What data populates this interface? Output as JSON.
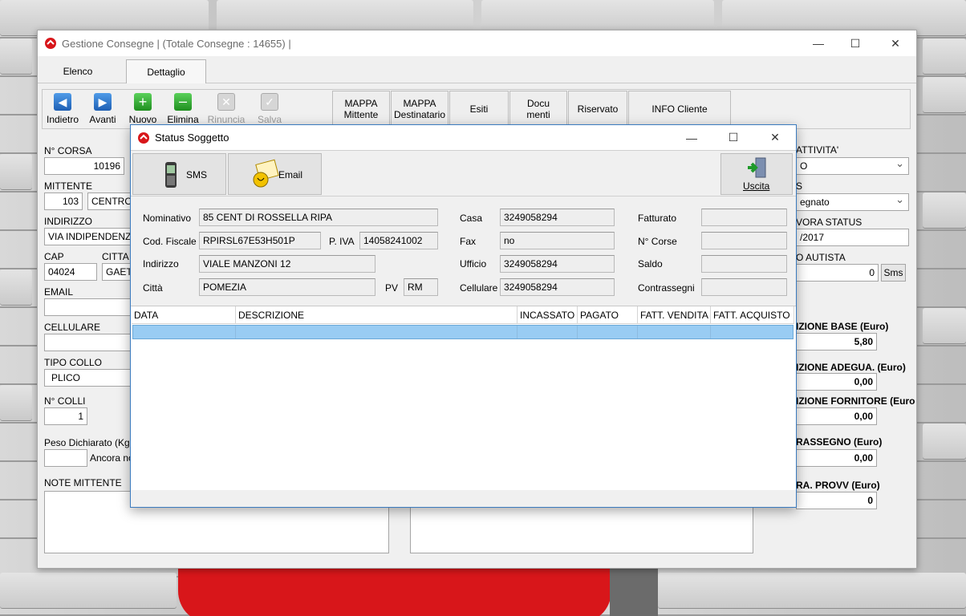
{
  "main": {
    "title": "Gestione Consegne | (Totale Consegne : 14655) |",
    "tabs": [
      {
        "label": "Elenco"
      },
      {
        "label": "Dettaglio"
      }
    ],
    "toolbar": {
      "indietro": "Indietro",
      "avanti": "Avanti",
      "nuovo": "Nuovo",
      "elimina": "Elimina",
      "rinuncia": "Rinuncia",
      "salva": "Salva"
    },
    "nav": {
      "mappa_mittente": [
        "MAPPA",
        "Mittente"
      ],
      "mappa_destinatario": [
        "MAPPA",
        "Destinatario"
      ],
      "esiti": "Esiti",
      "documenti": [
        "Docu",
        "menti"
      ],
      "riservato": "Riservato",
      "info_cliente": "INFO Cliente"
    },
    "form": {
      "corsa_label": "N° CORSA",
      "corsa_value": "10196",
      "mittente_label": "MITTENTE",
      "mittente_code": "103",
      "mittente_name": "CENTRO S",
      "indirizzo_label": "INDIRIZZO",
      "indirizzo_value": "VIA INDIPENDENZA",
      "cap_label": "CAP",
      "cap_value": "04024",
      "citta_label": "CITTA",
      "citta_value": "GAETA",
      "email_label": "EMAIL",
      "cellulare_label": "CELLULARE",
      "tipo_collo_label": "TIPO COLLO",
      "tipo_collo_value": "PLICO",
      "colli_label": "N° COLLI",
      "colli_value": "1",
      "peso_label": "Peso Dichiarato (Kg)",
      "ancora_label": "Ancora no",
      "note_label": "NOTE MITTENTE"
    },
    "right": {
      "attivita_label": "ATTIVITA'",
      "attivita_value": "O",
      "status_label": "S",
      "status_value": "egnato",
      "ora_status_label": "VORA STATUS",
      "ora_status_value": "/2017",
      "autista_label": "O AUTISTA",
      "autista_value": "0",
      "sms_button": "Sms",
      "base_label": "IZIONE BASE (Euro)",
      "base_value": "5,80",
      "adegua_label": "IZIONE ADEGUA. (Euro)",
      "adegua_value": "0,00",
      "fornitore_label": "IZIONE FORNITORE (Euro",
      "fornitore_value": "0,00",
      "contrassegno_label": "RASSEGNO (Euro)",
      "contrassegno_value": "0,00",
      "provv_label": "RA.  PROVV (Euro)",
      "provv_value": "0"
    }
  },
  "dialog": {
    "title": "Status Soggetto",
    "sms_button": "SMS",
    "email_button": "Email",
    "uscita_button": "Uscita",
    "nominativo_label": "Nominativo",
    "nominativo_value": "85 CENT DI ROSSELLA RIPA",
    "cf_label": "Cod. Fiscale",
    "cf_value": "RPIRSL67E53H501P",
    "piva_label": "P. IVA",
    "piva_value": "14058241002",
    "indirizzo_label": "Indirizzo",
    "indirizzo_value": "VIALE MANZONI 12",
    "citta_label": "Città",
    "citta_value": "POMEZIA",
    "pv_label": "PV",
    "pv_value": "RM",
    "casa_label": "Casa",
    "casa_value": "3249058294",
    "fax_label": "Fax",
    "fax_value": "no",
    "ufficio_label": "Ufficio",
    "ufficio_value": "3249058294",
    "cellulare_label": "Cellulare",
    "cellulare_value": "3249058294",
    "fatturato_label": "Fatturato",
    "corse_label": "N° Corse",
    "saldo_label": "Saldo",
    "contrassegni_label": "Contrassegni",
    "columns": [
      "DATA",
      "DESCRIZIONE",
      "INCASSATO",
      "PAGATO",
      "FATT. VENDITA",
      "FATT. ACQUISTO"
    ]
  },
  "colors": {
    "accent": "#3b7bbf",
    "selection": "#99ccf3",
    "shirt": "#d8161a"
  }
}
